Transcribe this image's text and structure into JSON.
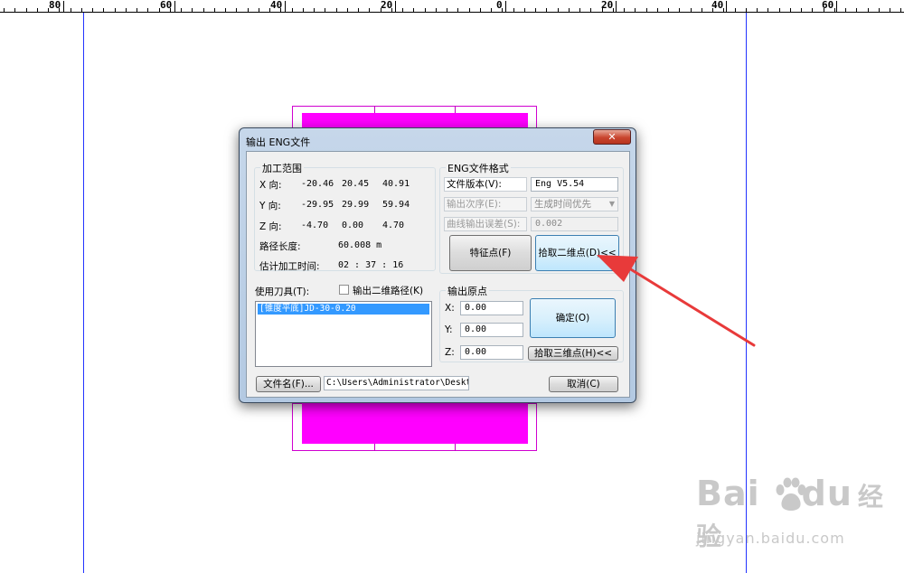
{
  "ruler": {
    "labels": [
      "80",
      "60",
      "40",
      "20",
      "0",
      "20",
      "40",
      "60"
    ]
  },
  "dialog": {
    "title": "输出 ENG文件",
    "close_label": "✕",
    "range_group": {
      "title": "加工范围",
      "rows": [
        {
          "label": "X 向:",
          "v1": "-20.46",
          "v2": "20.45",
          "v3": "40.91"
        },
        {
          "label": "Y 向:",
          "v1": "-29.95",
          "v2": "29.99",
          "v3": "59.94"
        },
        {
          "label": "Z 向:",
          "v1": "-4.70",
          "v2": "0.00",
          "v3": "4.70"
        }
      ],
      "path_length_label": "路径长度:",
      "path_length_value": "60.008 m",
      "time_label": "估计加工时间:",
      "time_value": "02 : 37 : 16"
    },
    "format_group": {
      "title": "ENG文件格式",
      "version_label": "文件版本(V):",
      "version_value": "Eng V5.54",
      "order_label": "输出次序(E):",
      "order_value": "生成时间优先",
      "tolerance_label": "曲线输出误差(S):",
      "tolerance_value": "0.002",
      "feature_button": "特征点(F)",
      "pick2d_button": "拾取二维点(D)<<"
    },
    "tools": {
      "label": "使用刀具(T):",
      "output2d_label": "输出二维路径(K)",
      "items": [
        "[锥度平底]JD-30-0.20"
      ]
    },
    "origin_group": {
      "title": "输出原点",
      "x_label": "X:",
      "x_value": "0.00",
      "y_label": "Y:",
      "y_value": "0.00",
      "z_label": "Z:",
      "z_value": "0.00",
      "ok_button": "确定(O)",
      "pick3d_button": "拾取三维点(H)<<"
    },
    "filename_button": "文件名(F)...",
    "path_value": "C:\\Users\\Administrator\\Desktop",
    "cancel_button": "取消(C)"
  },
  "watermark": {
    "brand_latin": "Bai",
    "brand_latin2": "du",
    "brand_cn": "经验",
    "url": "jingyan.baidu.com"
  },
  "colors": {
    "magenta": "#ff00ff",
    "guide_line": "#2233ff",
    "arrow": "#e83a3a",
    "button_blue": "#bee6fd"
  }
}
